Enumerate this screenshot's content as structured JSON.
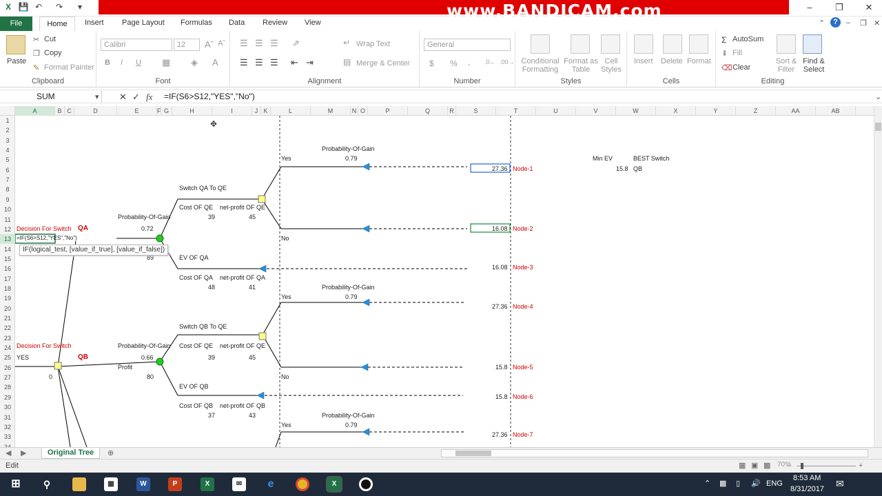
{
  "title_bar": {
    "recording_banner": "www.BANDICAM.com"
  },
  "ribbon_tabs": [
    "File",
    "Home",
    "Insert",
    "Page Layout",
    "Formulas",
    "Data",
    "Review",
    "View"
  ],
  "ribbon": {
    "clipboard": {
      "paste": "Paste",
      "cut": "Cut",
      "copy": "Copy",
      "format_painter": "Format Painter",
      "label": "Clipboard"
    },
    "font": {
      "name": "Calibri",
      "size": "12",
      "label": "Font",
      "bold": "B",
      "italic": "I",
      "underline": "U"
    },
    "alignment": {
      "wrap_text": "Wrap Text",
      "merge_center": "Merge & Center",
      "label": "Alignment"
    },
    "number": {
      "format": "General",
      "label": "Number",
      "currency": "$",
      "percent": "%",
      "comma": ","
    },
    "styles": {
      "conditional": "Conditional Formatting",
      "format_table": "Format as Table",
      "cell_styles": "Cell Styles",
      "label": "Styles"
    },
    "cells": {
      "insert": "Insert",
      "delete": "Delete",
      "format": "Format",
      "label": "Cells"
    },
    "editing": {
      "autosum": "AutoSum",
      "fill": "Fill",
      "clear": "Clear",
      "sort_filter": "Sort & Filter",
      "find_select": "Find & Select",
      "label": "Editing"
    }
  },
  "formula_bar": {
    "name_box": "SUM",
    "formula": "=IF(S6>S12,\"YES\",\"No\")",
    "fx": "fx"
  },
  "columns": [
    "A",
    "B",
    "C",
    "D",
    "E",
    "F",
    "G",
    "H",
    "I",
    "J",
    "K",
    "L",
    "M",
    "N",
    "O",
    "P",
    "Q",
    "R",
    "S",
    "T",
    "U",
    "V",
    "W",
    "X",
    "Y",
    "Z",
    "AA",
    "AB"
  ],
  "rows": [
    "1",
    "2",
    "3",
    "4",
    "5",
    "6",
    "7",
    "8",
    "9",
    "10",
    "11",
    "12",
    "13",
    "14",
    "15",
    "16",
    "17",
    "18",
    "19",
    "20",
    "21",
    "22",
    "23",
    "24",
    "25",
    "26",
    "27",
    "28",
    "29",
    "30",
    "31",
    "32",
    "33",
    "34"
  ],
  "cells": {
    "prob_gain_1": "Probability-Of-Gain",
    "prob_1": "0.79",
    "yes_1": "Yes",
    "min_ev_label": "Min EV",
    "best_switch_label": "BEST Switch",
    "min_ev": "15.8",
    "best_switch": "QB",
    "s6": "27.36",
    "node1": "Node-1",
    "switch_qa_qe": "Switch QA To QE",
    "cost_qe_1": "Cost OF QE",
    "net_qe_1": "net-profit OF QE",
    "cost_qe_1_v": "39",
    "net_qe_1_v": "45",
    "prob_gain_2": "Probability-Of-Gain",
    "prob_2": "0.72",
    "decision_qa": "Decision For Switch",
    "qa": "QA",
    "s12": "16.08",
    "node2": "Node-2",
    "no_1": "No",
    "edit_formula": "=IF(S6>S12,\"YES\",\"No\")",
    "tooltip": "IF(logical_test, [value_if_true], [value_if_false])",
    "val_89": "89",
    "ev_qa": "EV OF QA",
    "s16": "16.08",
    "node3": "Node-3",
    "cost_qa": "Cost OF QA",
    "net_qa": "net-profit OF QA",
    "cost_qa_v": "48",
    "net_qa_v": "41",
    "prob_gain_3": "Probability-Of-Gain",
    "prob_3": "0.79",
    "yes_2": "Yes",
    "s20": "27.36",
    "node4": "Node-4",
    "switch_qb_qe": "Switch QB To QE",
    "decision_qb": "Decision For Switch",
    "prob_gain_4": "Probability-Of-Gain",
    "cost_qe_2": "Cost OF QE",
    "net_qe_2": "net-profit OF QE",
    "yes_3": "YES",
    "qb": "QB",
    "prob_4": "0.66",
    "cost_qe_2_v": "39",
    "net_qe_2_v": "45",
    "profit": "Profit",
    "s26": "15.8",
    "node5": "Node-5",
    "zero": "0",
    "val_80": "80",
    "no_2": "No",
    "ev_qb": "EV OF QB",
    "s29": "15.8",
    "node6": "Node-6",
    "cost_qb": "Cost OF QB",
    "net_qb": "net-profit OF QB",
    "cost_qb_v": "37",
    "net_qb_v": "43",
    "prob_gain_5": "Probability-Of-Gain",
    "prob_5": "0.79",
    "yes_4": "Yes",
    "s33": "27.36",
    "node7": "Node-7"
  },
  "sheet_tab": "Original Tree",
  "status": {
    "mode": "Edit",
    "zoom": "70%"
  },
  "taskbar": {
    "time": "8:53 AM",
    "date": "8/31/2017",
    "lang": "ENG"
  }
}
